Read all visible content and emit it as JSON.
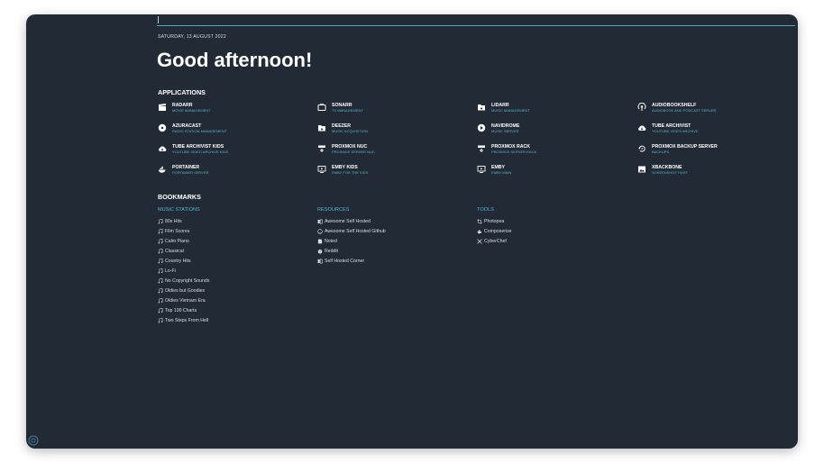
{
  "header": {
    "date": "SATURDAY, 13 AUGUST 2022",
    "greeting": "Good afternoon!"
  },
  "applications": {
    "title": "APPLICATIONS",
    "items": [
      {
        "name": "RADARR",
        "desc": "MOVIE MANAGEMENT",
        "icon": "clapperboard-icon"
      },
      {
        "name": "SONARR",
        "desc": "TV MANAGEMENT",
        "icon": "tv-icon"
      },
      {
        "name": "LIDARR",
        "desc": "MUSIC MANAGEMENT",
        "icon": "music-folder-icon"
      },
      {
        "name": "AUDIOBOOKSHELF",
        "desc": "AUDIOBOOK AND PODCAST SERVER",
        "icon": "podcast-icon"
      },
      {
        "name": "AZURACAST",
        "desc": "RADIO STATION MANAGEMENT",
        "icon": "disc-icon"
      },
      {
        "name": "DEEZER",
        "desc": "MUSIC ACQUISITION",
        "icon": "music-folder-icon"
      },
      {
        "name": "NAVIDROME",
        "desc": "MUSIC SERVER",
        "icon": "play-circle-icon"
      },
      {
        "name": "TUBE ARCHIVIST",
        "desc": "YOUTUBE VIDEO ARCHIVE",
        "icon": "cloud-download-icon"
      },
      {
        "name": "TUBE ARCHIVIST KIDS",
        "desc": "YOUTUBE VIDEO ARCHIVE KIDS",
        "icon": "cloud-download-icon"
      },
      {
        "name": "PROXMOX NUC",
        "desc": "PROXMOX SERVER NUC",
        "icon": "server-plus-icon"
      },
      {
        "name": "PROXMOX RACK",
        "desc": "PROXMOX SERVER RACK",
        "icon": "server-plus-icon"
      },
      {
        "name": "PROXMOX BACKUP SERVER",
        "desc": "BACKUPS",
        "icon": "backup-restore-icon"
      },
      {
        "name": "PORTAINER",
        "desc": "PORTAINER SERVER",
        "icon": "docker-icon"
      },
      {
        "name": "EMBY KIDS",
        "desc": "EMBY FOR THE KIDS",
        "icon": "monitor-play-icon"
      },
      {
        "name": "EMBY",
        "desc": "EMBY MAIN",
        "icon": "monitor-play-icon"
      },
      {
        "name": "XBACKBONE",
        "desc": "SCREENSHOT HOST",
        "icon": "image-icon"
      }
    ]
  },
  "bookmarks": {
    "title": "BOOKMARKS",
    "groups": [
      {
        "name": "MUSIC STATIONS",
        "items": [
          {
            "label": "80s Hits",
            "icon": "music-note-icon"
          },
          {
            "label": "Film Scores",
            "icon": "music-note-icon"
          },
          {
            "label": "Calm Piano",
            "icon": "music-note-icon"
          },
          {
            "label": "Classical",
            "icon": "music-note-icon"
          },
          {
            "label": "Country Hits",
            "icon": "music-note-icon"
          },
          {
            "label": "Lo-Fi",
            "icon": "music-note-icon"
          },
          {
            "label": "No Copyright Sounds",
            "icon": "music-note-icon"
          },
          {
            "label": "Oldies but Goodies",
            "icon": "music-note-icon"
          },
          {
            "label": "Oldies Vietnam Era",
            "icon": "music-note-icon"
          },
          {
            "label": "Top 100 Charts",
            "icon": "music-note-icon"
          },
          {
            "label": "Two Steps From Hell",
            "icon": "music-note-icon"
          }
        ]
      },
      {
        "name": "RESOURCES",
        "items": [
          {
            "label": "Awesome Self Hosted",
            "icon": "book-icon"
          },
          {
            "label": "Awesome Self Hosted Github",
            "icon": "github-icon"
          },
          {
            "label": "Noted",
            "icon": "note-icon"
          },
          {
            "label": "Reddit",
            "icon": "reddit-icon"
          },
          {
            "label": "Self Hosted Corner",
            "icon": "book-icon"
          }
        ]
      },
      {
        "name": "TOOLS",
        "items": [
          {
            "label": "Photopea",
            "icon": "crop-icon"
          },
          {
            "label": "Composerize",
            "icon": "docker-icon"
          },
          {
            "label": "CyberChef",
            "icon": "knife-icon"
          }
        ]
      }
    ]
  },
  "colors": {
    "background": "#222a35",
    "accent": "#55b4d4",
    "text": "#ffffff"
  }
}
